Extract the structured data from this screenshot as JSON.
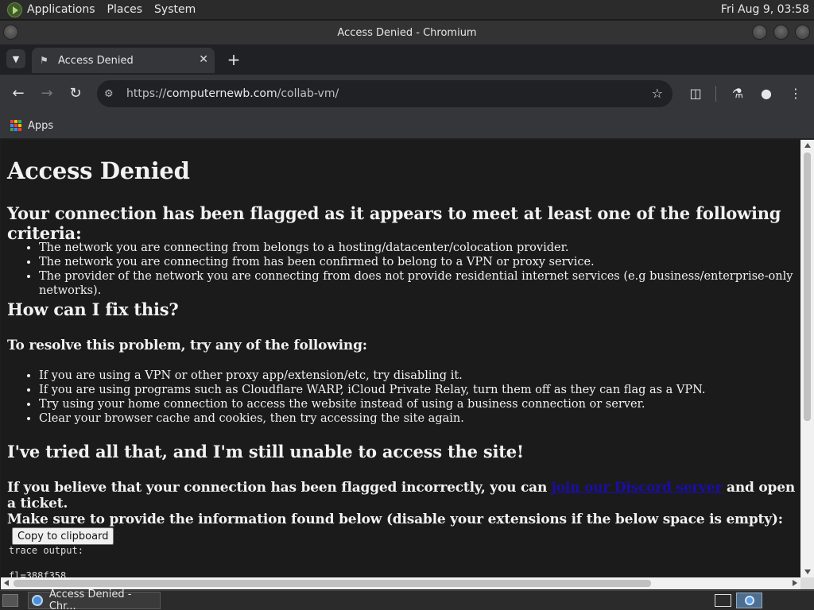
{
  "top_panel": {
    "menus": [
      "Applications",
      "Places",
      "System"
    ],
    "clock": "Fri Aug  9, 03:58"
  },
  "window": {
    "title": "Access Denied - Chromium"
  },
  "tab": {
    "title": "Access Denied",
    "close": "✕",
    "new_tab": "+"
  },
  "toolbar": {
    "url_scheme": "https://",
    "url_host": "computernewb.com",
    "url_path": "/collab-vm/"
  },
  "bookmarks": {
    "apps_label": "Apps",
    "apps_colors": [
      "#ea4335",
      "#fbbc04",
      "#34a853",
      "#4285f4",
      "#ea4335",
      "#fbbc04",
      "#34a853",
      "#4285f4",
      "#ea4335"
    ]
  },
  "page": {
    "heading": "Access Denied",
    "criteria_heading": "Your connection has been flagged as it appears to meet at least one of the following criteria:",
    "criteria": [
      "The network you are connecting from belongs to a hosting/datacenter/colocation provider.",
      "The network you are connecting from has been confirmed to belong to a VPN or proxy service.",
      "The provider of the network you are connecting from does not provide residential internet services (e.g business/enterprise-only networks)."
    ],
    "fix_heading": "How can I fix this?",
    "resolve_heading": "To resolve this problem, try any of the following:",
    "fixes": [
      "If you are using a VPN or other proxy app/extension/etc, try disabling it.",
      "If you are using programs such as Cloudflare WARP, iCloud Private Relay, turn them off as they can flag as a VPN.",
      "Try using your home connection to access the website instead of using a business connection or server.",
      "Clear your browser cache and cookies, then try accessing the site again."
    ],
    "tried_heading": "I've tried all that, and I'm still unable to access the site!",
    "believe_text_before": "If you believe that your connection has been flagged incorrectly, you can ",
    "discord_link": "join our Discord server",
    "believe_text_after": " and open a ticket.",
    "provide_text": "Make sure to provide the information found below (disable your extensions if the below space is empty):",
    "copy_button": "Copy to clipboard",
    "trace_label": "trace output:",
    "trace_first_line": "fl=388f358"
  },
  "taskbar": {
    "task_label": "Access Denied - Chr..."
  }
}
